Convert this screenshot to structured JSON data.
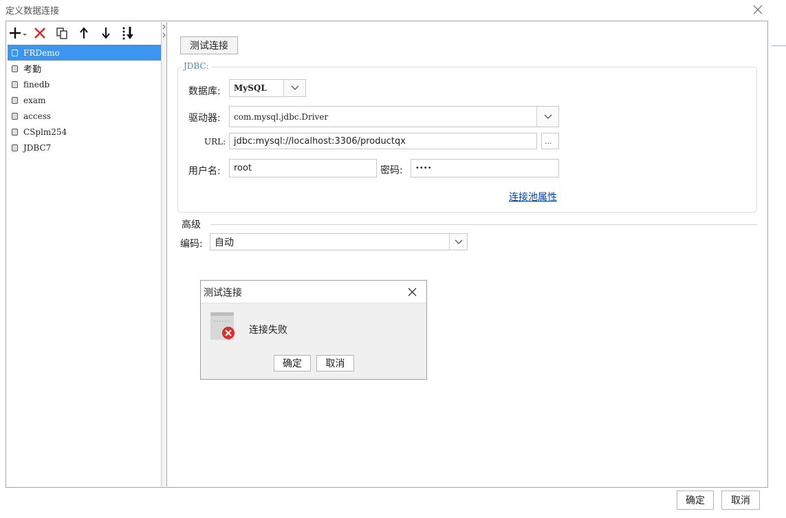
{
  "window": {
    "title": "定义数据连接"
  },
  "toolbar": {
    "icons": [
      "add-icon",
      "delete-icon",
      "copy-icon",
      "move-up-icon",
      "move-down-icon",
      "sort-icon"
    ]
  },
  "connections": [
    {
      "name": "FRDemo",
      "selected": true
    },
    {
      "name": "考勤",
      "selected": false
    },
    {
      "name": "finedb",
      "selected": false
    },
    {
      "name": "exam",
      "selected": false
    },
    {
      "name": "access",
      "selected": false
    },
    {
      "name": "CSplm254",
      "selected": false
    },
    {
      "name": "JDBC7",
      "selected": false
    }
  ],
  "form": {
    "test_button": "测试连接",
    "jdbc_legend": "JDBC:",
    "db_label": "数据库:",
    "db_value": "MySQL",
    "driver_label": "驱动器:",
    "driver_value": "com.mysql.jdbc.Driver",
    "url_label": "URL:",
    "url_value": "jdbc:mysql://localhost:3306/productqx",
    "url_browse": "...",
    "user_label": "用户名:",
    "user_value": "root",
    "password_label": "密码:",
    "password_value": "••••",
    "pool_link": "连接池属性",
    "advanced_title": "高级",
    "encoding_label": "编码:",
    "encoding_value": "自动"
  },
  "message_dialog": {
    "title": "测试连接",
    "message": "连接失败",
    "ok": "确定",
    "cancel": "取消"
  },
  "footer": {
    "ok": "确定",
    "cancel": "取消"
  },
  "colors": {
    "selection": "#3c96f0",
    "legend": "#3b8fd8",
    "error": "#e02a2a",
    "link": "#0645ad"
  }
}
